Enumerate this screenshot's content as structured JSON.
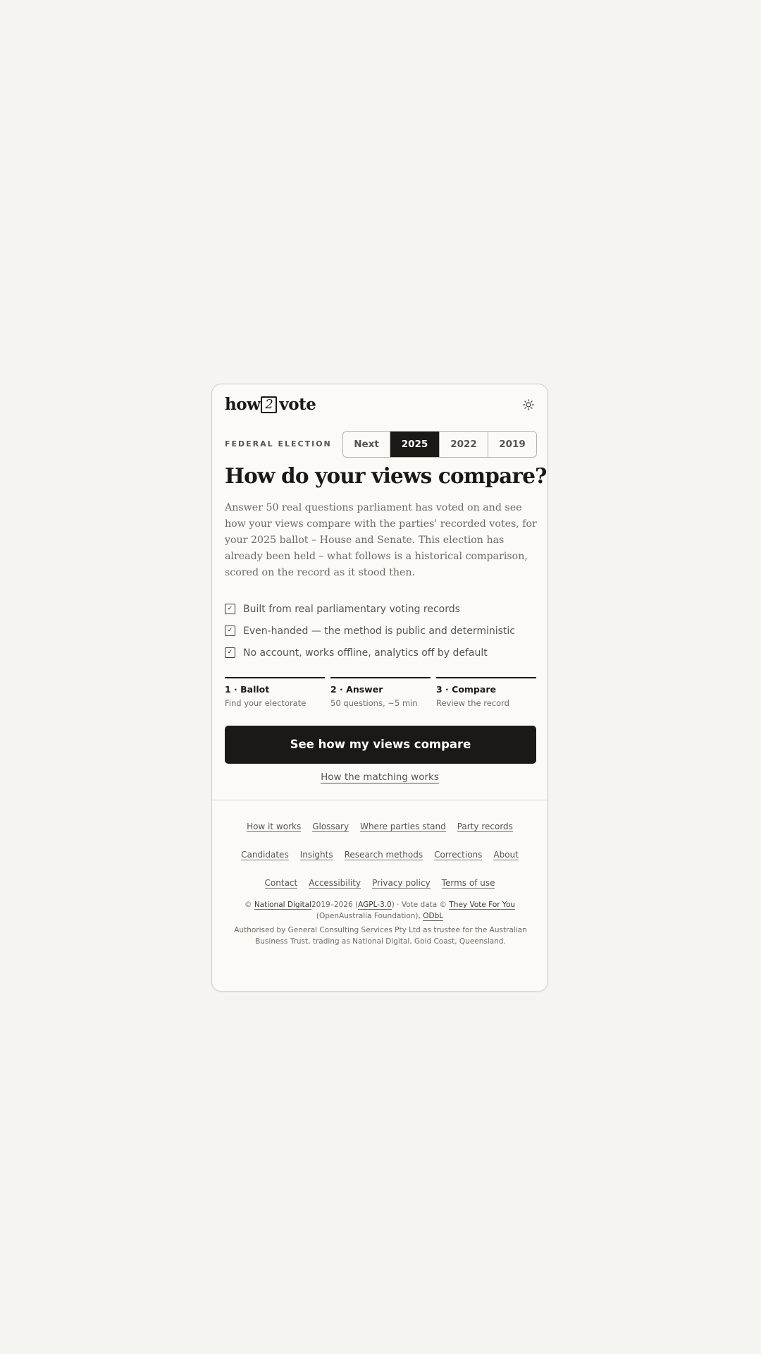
{
  "header": {
    "logo_prefix": "how",
    "logo_digit": "2",
    "logo_suffix": "vote",
    "theme_toggle_icon": "sun-icon"
  },
  "election": {
    "kicker": "FEDERAL ELECTION",
    "tabs": [
      {
        "label": "Next",
        "active": false
      },
      {
        "label": "2025",
        "active": true
      },
      {
        "label": "2022",
        "active": false
      },
      {
        "label": "2019",
        "active": false
      }
    ]
  },
  "hero": {
    "title": "How do your views compare?",
    "lede": "Answer 50 real questions parliament has voted on and see how your views compare with the parties' recorded votes, for your 2025 ballot – House and Senate. This election has already been held – what follows is a historical comparison, scored on the record as it stood then."
  },
  "features": [
    {
      "icon": "checkbox-checked-icon",
      "mark": "✓",
      "text": "Built from real parliamentary voting records"
    },
    {
      "icon": "checkbox-checked-icon",
      "mark": "✓",
      "text": "Even-handed — the method is public and deterministic"
    },
    {
      "icon": "checkbox-checked-icon",
      "mark": "✓",
      "text": "No account, works offline, analytics off by default"
    }
  ],
  "steps": [
    {
      "title": "1 · Ballot",
      "subtitle": "Find your electorate"
    },
    {
      "title": "2 · Answer",
      "subtitle": "50 questions, ~5 min"
    },
    {
      "title": "3 · Compare",
      "subtitle": "Review the record"
    }
  ],
  "cta": {
    "primary_label": "See how my views compare",
    "secondary_label": "How the matching works"
  },
  "footer": {
    "nav_rows": [
      [
        "How it works",
        "Glossary",
        "Where parties stand",
        "Party records"
      ],
      [
        "Candidates",
        "Insights",
        "Research methods",
        "Corrections",
        "About"
      ],
      [
        "Contact",
        "Accessibility",
        "Privacy policy",
        "Terms of use"
      ]
    ],
    "legal": {
      "copyright_symbol": "©",
      "org_link": "National Digital",
      "years": "2019–2026 (",
      "license_link": "AGPL-3.0",
      "vote_data_text": ") · Vote data ©",
      "tvfy_link": "They Vote For You",
      "oa_text": "(OpenAustralia Foundation),",
      "odbl_link": "ODbL",
      "authorised": "Authorised by General Consulting Services Pty Ltd as trustee for the Australian Business Trust, trading as National Digital, Gold Coast, Queensland."
    }
  },
  "colors": {
    "page_background": "#f5f4f0",
    "card_background": "#fbfaf7",
    "ink": "#1a1916",
    "muted_text": "#6e6a63",
    "active_tab": "#1a1916"
  }
}
